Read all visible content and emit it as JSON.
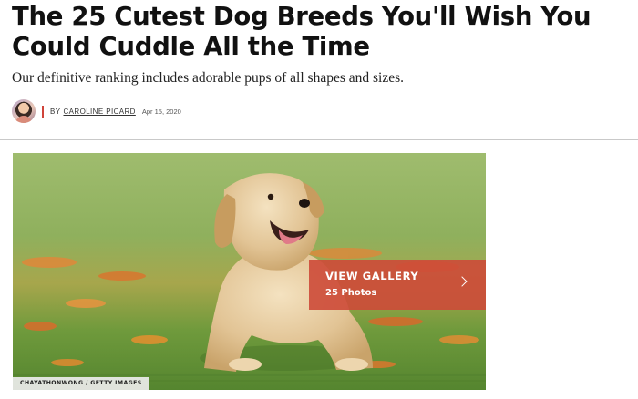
{
  "article": {
    "headline": "The 25 Cutest Dog Breeds You'll Wish You Could Cuddle All the Time",
    "dek": "Our definitive ranking includes adorable pups of all shapes and sizes.",
    "byline": {
      "prefix": "BY",
      "author": "CAROLINE PICARD",
      "date": "Apr 15, 2020"
    }
  },
  "hero": {
    "gallery_label": "VIEW GALLERY",
    "photo_count": "25 Photos",
    "credit": "CHAYATHONWONG / GETTY IMAGES",
    "icons": {
      "next": "chevron-right-icon"
    }
  },
  "colors": {
    "accent": "#cd4a38",
    "byline_bar": "#d0443a"
  }
}
